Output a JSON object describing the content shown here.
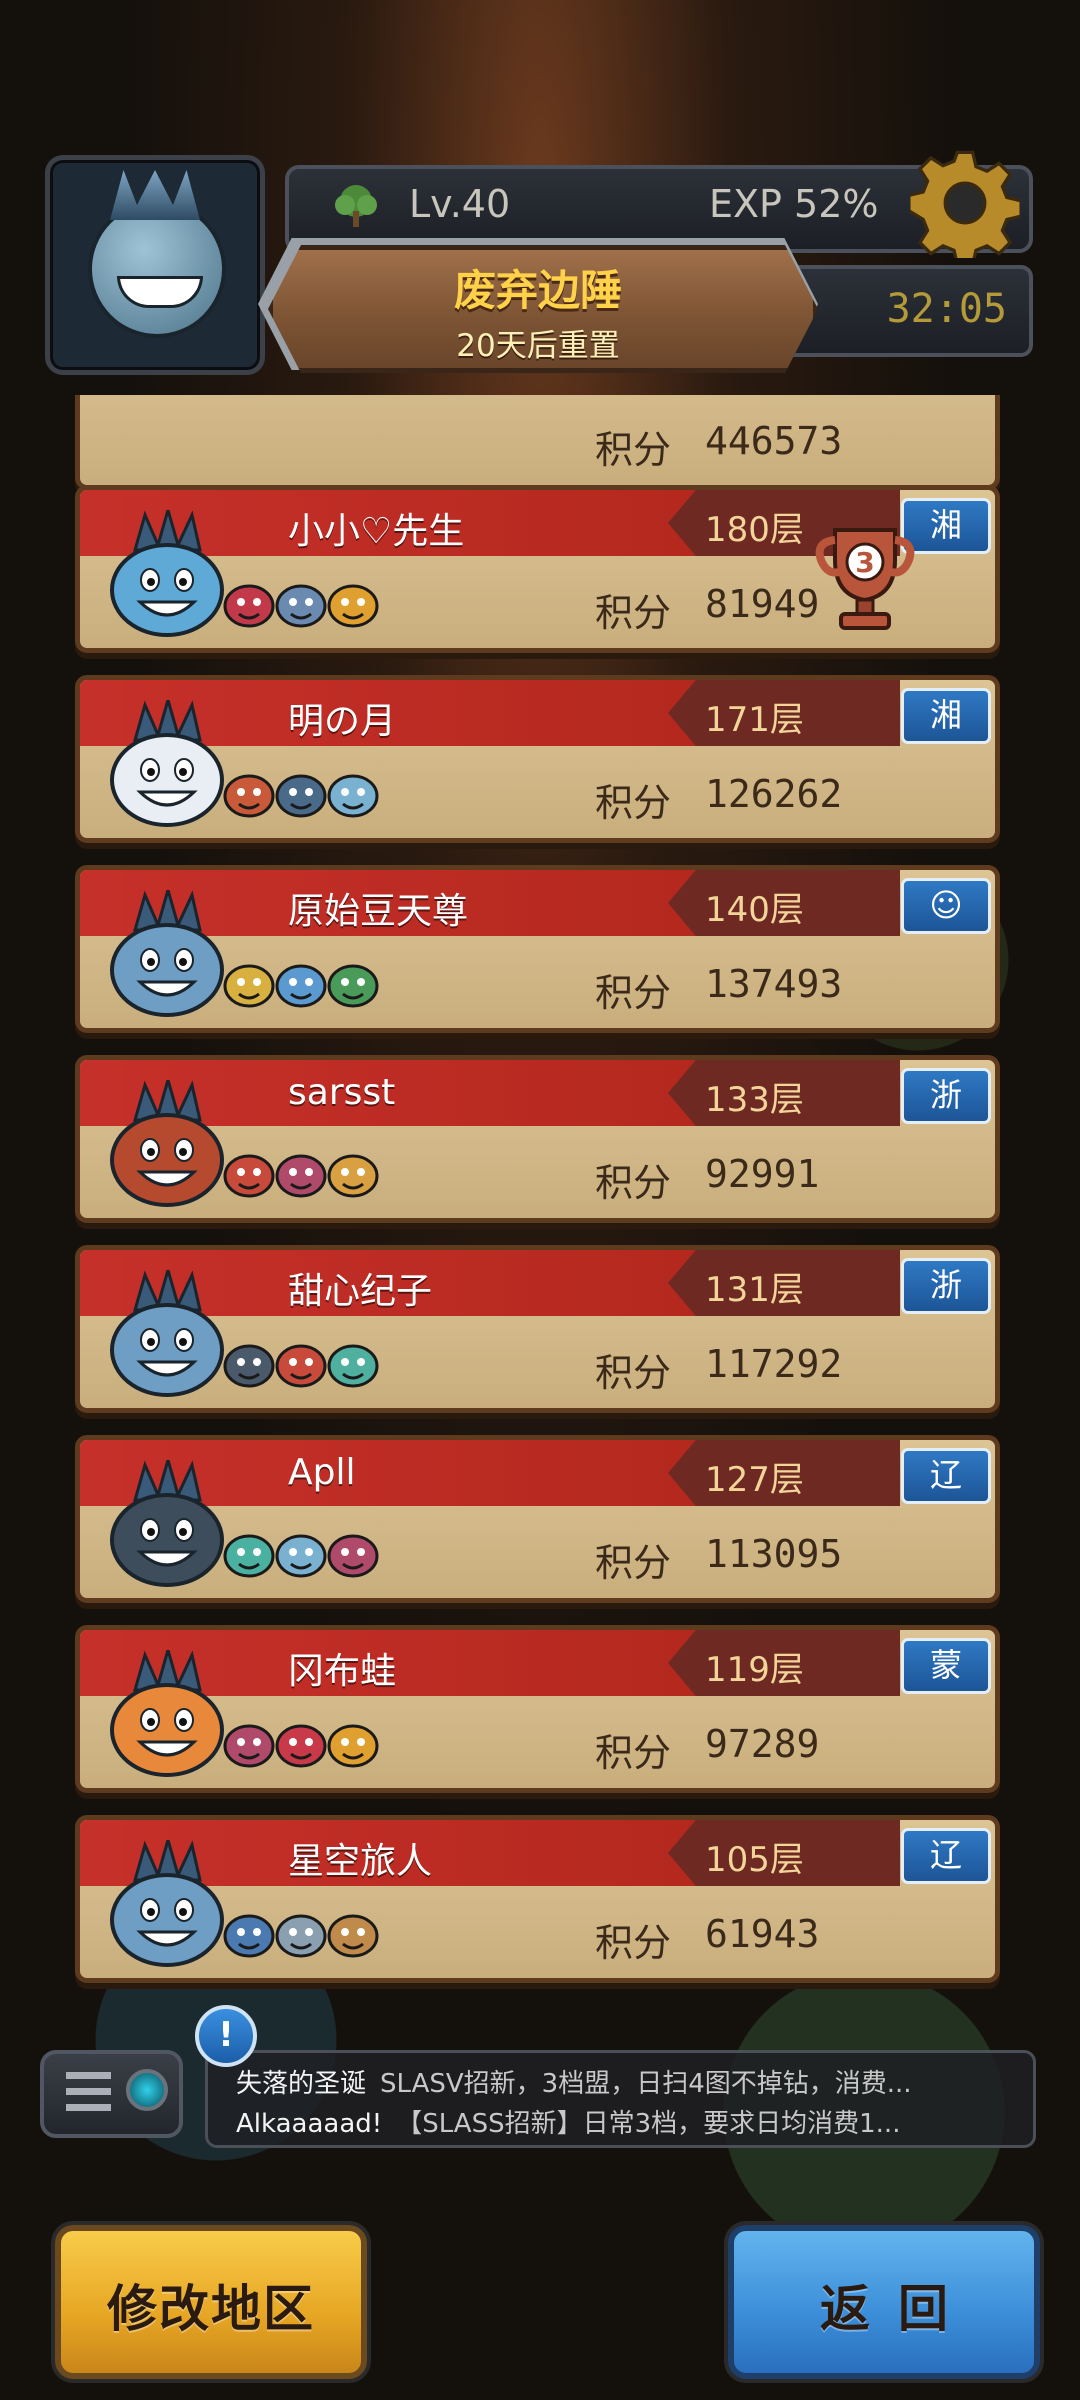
{
  "header": {
    "level": "Lv.40",
    "exp": "EXP 52%",
    "area_title": "废弃边陲",
    "reset_note": "20天后重置",
    "timer": "32:05"
  },
  "leaderboard": {
    "score_label": "积分",
    "top_partial_score": "446573",
    "rows": [
      {
        "name": "小小♡先生",
        "floor": "180层",
        "score": "81949",
        "region": "湘",
        "monster_color": "#5fa9d6"
      },
      {
        "name": "明の月",
        "floor": "171层",
        "score": "126262",
        "region": "湘",
        "monster_color": "#e9eef5"
      },
      {
        "name": "原始豆天尊",
        "floor": "140层",
        "score": "137493",
        "region": "☺",
        "monster_color": "#6f9ec4"
      },
      {
        "name": "sarsst",
        "floor": "133层",
        "score": "92991",
        "region": "浙",
        "monster_color": "#b54a2f"
      },
      {
        "name": "甜心纪子",
        "floor": "131层",
        "score": "117292",
        "region": "浙",
        "monster_color": "#6f9ec4"
      },
      {
        "name": "Apll",
        "floor": "127层",
        "score": "113095",
        "region": "辽",
        "monster_color": "#3d4d5c"
      },
      {
        "name": "冈布蛙",
        "floor": "119层",
        "score": "97289",
        "region": "蒙",
        "monster_color": "#e8883a"
      },
      {
        "name": "星空旅人",
        "floor": "105层",
        "score": "61943",
        "region": "辽",
        "monster_color": "#6f9ec4"
      }
    ]
  },
  "chat": {
    "line1_who": "失落的圣诞",
    "line1_msg": "SLASV招新，3档盟，日扫4图不掉钻，消费...",
    "line2_who": "Alkaaaaad!",
    "line2_msg": "【SLASS招新】日常3档，要求日均消费1...",
    "alert": "!"
  },
  "buttons": {
    "change_region": "修改地区",
    "back": "返回"
  },
  "colors": {
    "row_banner": "#c6302a",
    "region_badge": "#2f79c4",
    "gold_button": "#e6a623",
    "blue_button": "#3b8dd8"
  }
}
